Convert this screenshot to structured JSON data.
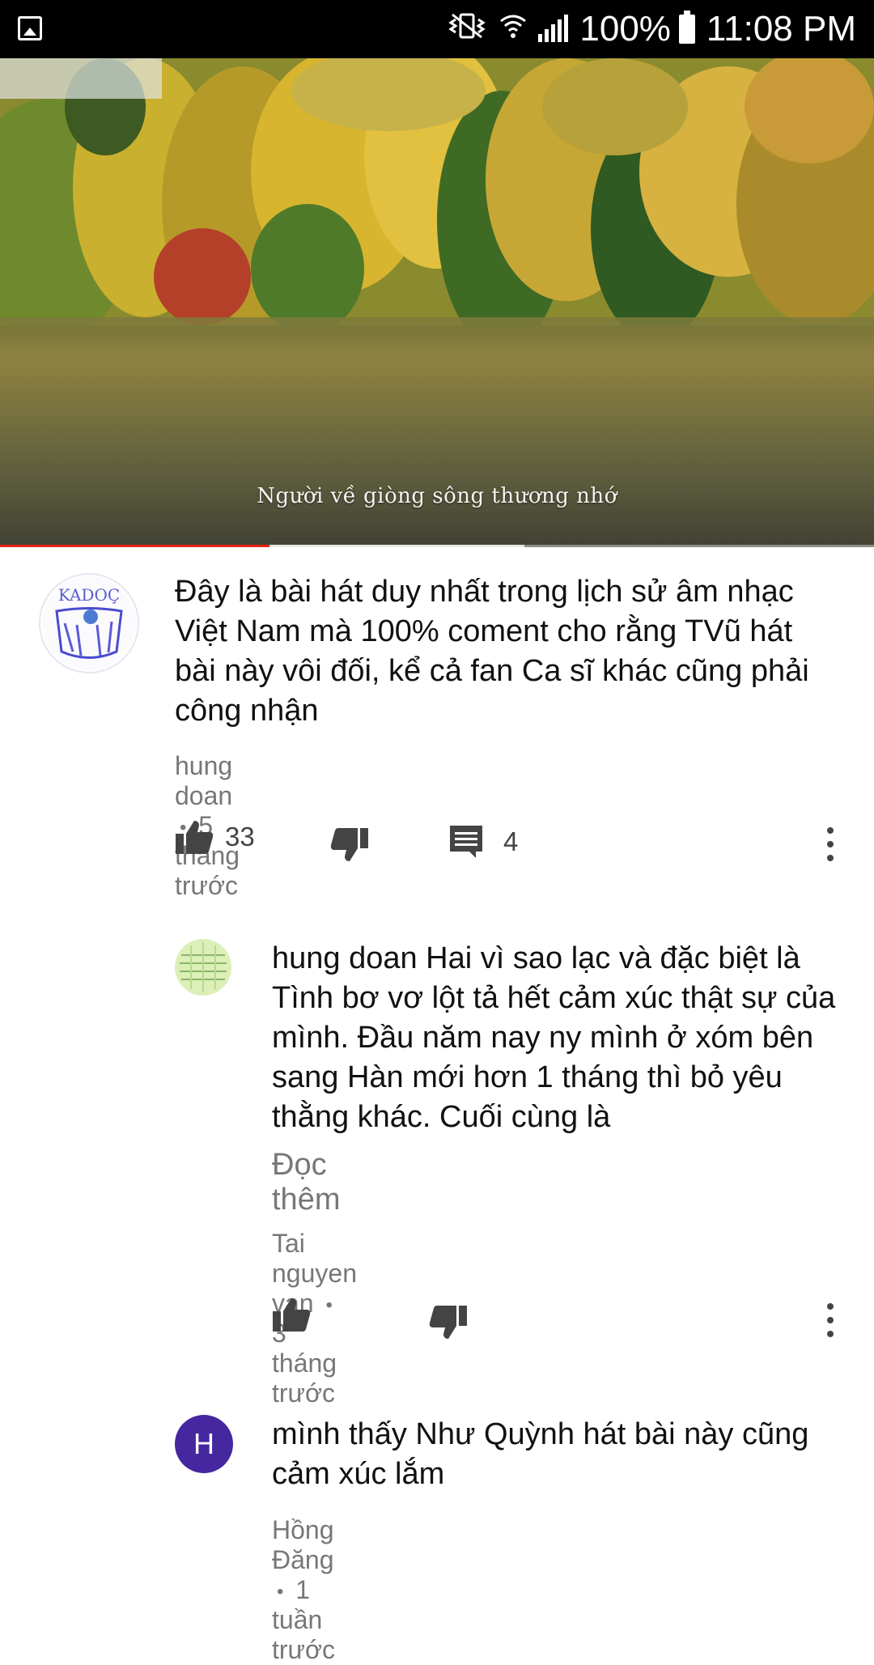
{
  "status_bar": {
    "battery": "100%",
    "time": "11:08 PM"
  },
  "video": {
    "subtitle": "Người về giòng sông thương nhớ",
    "progress": 0.308,
    "buffered": 0.6
  },
  "comments": [
    {
      "text": "Đây là bài hát duy nhất trong lịch sử âm nhạc Việt Nam mà 100% coment cho rằng TVũ hát bài này vôi đối, kể cả fan Ca sĩ khác cũng phải công nhận",
      "author": "hung doan",
      "time": "5 tháng trước",
      "likes": "33",
      "replies": "4"
    },
    {
      "text": "hung doan Hai vì sao lạc và đặc biệt là Tình bơ vơ lột tả hết cảm xúc thật sự của mình. Đầu năm nay ny mình ở xóm bên sang Hàn mới hơn 1 tháng thì bỏ yêu thằng khác. Cuối cùng là",
      "read_more": "Đọc thêm",
      "author": "Tai nguyen van",
      "time": "3 tháng trước"
    },
    {
      "avatar_letter": "H",
      "avatar_color": "#4527a0",
      "text": "mình thấy Như Quỳnh hát bài này cũng cảm xúc lắm",
      "author": "Hồng Đăng",
      "time": "1 tuần trước"
    }
  ],
  "separator": "•"
}
